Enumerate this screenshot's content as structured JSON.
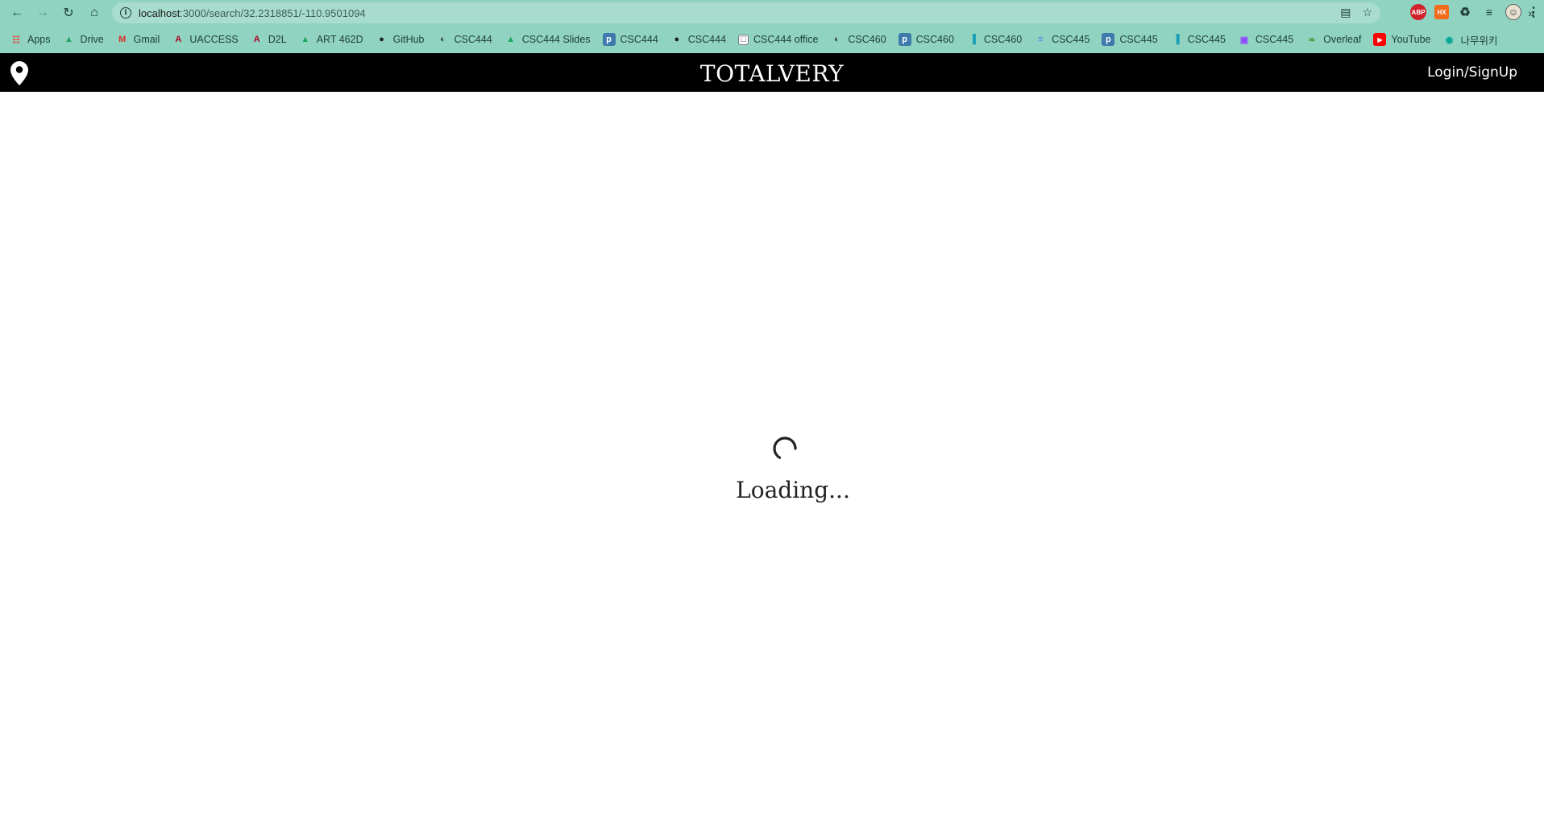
{
  "browser": {
    "url_host": "localhost",
    "url_path": ":3000/search/32.2318851/-110.9501094"
  },
  "bookmarks": [
    {
      "label": "Apps",
      "icon": "apps-grid-icon",
      "color": "#e94335"
    },
    {
      "label": "Drive",
      "icon": "google-drive-icon",
      "color": "#1fa463"
    },
    {
      "label": "Gmail",
      "icon": "gmail-icon",
      "color": "#d93025"
    },
    {
      "label": "UACCESS",
      "icon": "arizona-a-icon",
      "color": "#ab0520"
    },
    {
      "label": "D2L",
      "icon": "arizona-a-icon",
      "color": "#ab0520"
    },
    {
      "label": "ART 462D",
      "icon": "google-drive-icon",
      "color": "#1fa463"
    },
    {
      "label": "GitHub",
      "icon": "github-icon",
      "color": "#1b1f23"
    },
    {
      "label": "CSC444",
      "icon": "globe-icon",
      "color": "#2b3a36"
    },
    {
      "label": "CSC444 Slides",
      "icon": "google-drive-icon",
      "color": "#1fa463"
    },
    {
      "label": "CSC444",
      "icon": "piazza-icon",
      "color": "#3e7aab"
    },
    {
      "label": "CSC444",
      "icon": "github-icon",
      "color": "#1b1f23"
    },
    {
      "label": "CSC444 office",
      "icon": "calendar-icon",
      "color": "#ffffff"
    },
    {
      "label": "CSC460",
      "icon": "globe-icon",
      "color": "#2b3a36"
    },
    {
      "label": "CSC460",
      "icon": "piazza-icon",
      "color": "#3e7aab"
    },
    {
      "label": "CSC460",
      "icon": "bar-chart-icon",
      "color": "#1a9fb8"
    },
    {
      "label": "CSC445",
      "icon": "docs-icon",
      "color": "#4285f4"
    },
    {
      "label": "CSC445",
      "icon": "piazza-icon",
      "color": "#3e7aab"
    },
    {
      "label": "CSC445",
      "icon": "bar-chart-icon",
      "color": "#1a9fb8"
    },
    {
      "label": "CSC445",
      "icon": "twitch-icon",
      "color": "#9146ff"
    },
    {
      "label": "Overleaf",
      "icon": "overleaf-icon",
      "color": "#47a141"
    },
    {
      "label": "YouTube",
      "icon": "youtube-icon",
      "color": "#ff0000"
    },
    {
      "label": "나무위키",
      "icon": "namuwiki-icon",
      "color": "#00a495"
    }
  ],
  "extensions": {
    "abp": "ABP",
    "hx": "HX"
  },
  "app": {
    "title": "TOTALVERY",
    "login_label": "Login/SignUp"
  },
  "loading": {
    "text": "Loading..."
  },
  "colors": {
    "browser_chrome": "#8fd3c0",
    "header_bg": "#000000",
    "header_text": "#ffffff"
  }
}
